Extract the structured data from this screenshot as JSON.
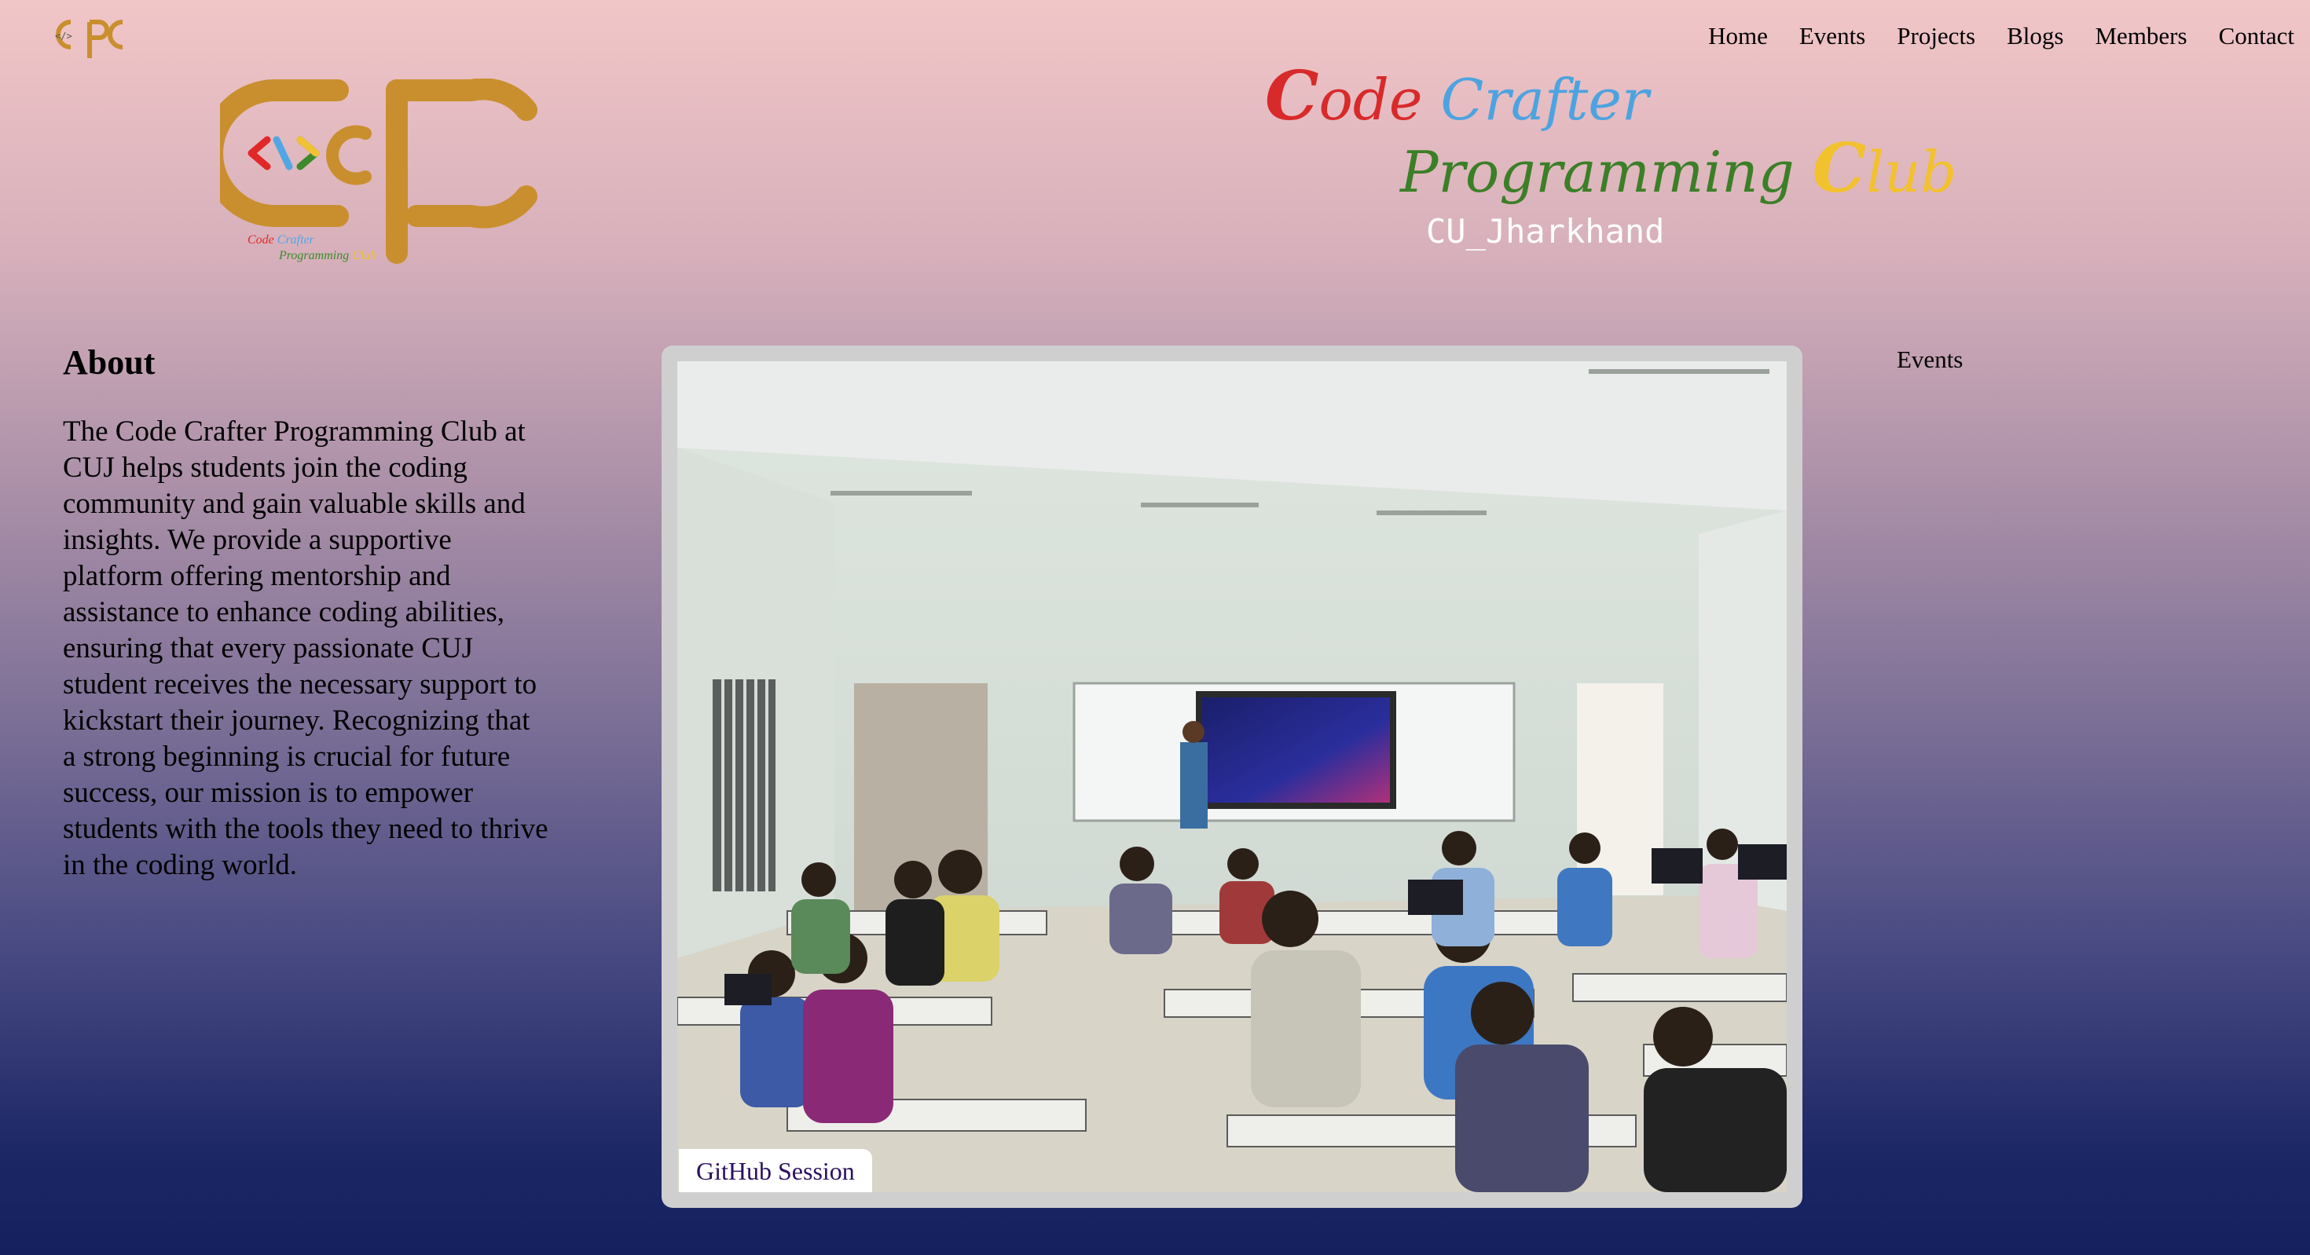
{
  "nav": {
    "items": [
      "Home",
      "Events",
      "Projects",
      "Blogs",
      "Members",
      "Contact"
    ]
  },
  "logo": {
    "small_text": "Code Crafter Programming Club",
    "monogram": "CPC",
    "colors": {
      "gold": "#c98f2e",
      "red": "#e02828",
      "blue": "#52a6e6",
      "green": "#3c8a2c",
      "yellow": "#f0c234"
    }
  },
  "hero": {
    "code_c": "C",
    "code_rest": "ode",
    "crafter": "Crafter",
    "programming": "Programming",
    "club_c": "C",
    "club_rest": "lub",
    "subtitle": "CU_Jharkhand",
    "colors": {
      "code": "#d82a2a",
      "crafter": "#4da3e0",
      "programming": "#3b7f27",
      "club": "#f2c12e",
      "subtitle": "#ffffff"
    }
  },
  "about": {
    "heading": "About",
    "body": "The Code Crafter Programming Club at CUJ helps students join the coding community and gain valuable skills and insights. We provide a supportive platform offering mentorship and assistance to enhance coding abilities, ensuring that every passionate CUJ student receives the necessary support to kickstart their journey. Recognizing that a strong beginning is crucial for future success, our mission is to empower students with the tools they need to thrive in the coding world."
  },
  "slideshow": {
    "caption": "GitHub Session",
    "image_description": "classroom-presentation-photo"
  },
  "side": {
    "events_label": "Events"
  },
  "background": {
    "top": "#f1c6c7",
    "bottom": "#15215e"
  }
}
